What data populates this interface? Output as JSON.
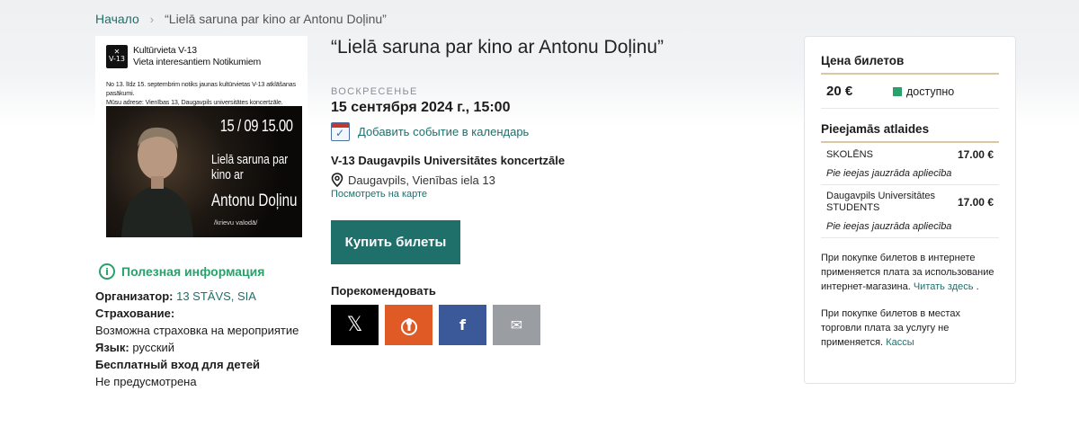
{
  "breadcrumb": {
    "home": "Начало",
    "separator": "›",
    "current": "“Lielā saruna par kino ar Antonu Doļinu”"
  },
  "poster": {
    "org_line1": "Kultūrvieta V-13",
    "org_line2": "Vieta interesantiem Notikumiem",
    "desc_line1": "No 13. līdz 15. septembrim notiks jaunas kultūrvietas V-13 atklāšanas pasākumi.",
    "desc_line2": "Mūsu adrese: Vienības 13, Daugavpils universitātes koncertzāle.",
    "date": "15 / 09 15.00",
    "title": "Lielā saruna par kino ar",
    "name": "Antonu Doļinu",
    "language": "/krievu valodā/"
  },
  "info": {
    "title": "Полезная информация",
    "organizer_label": "Организатор:",
    "organizer_value": "13 STĀVS, SIA",
    "insurance_label": "Страхование:",
    "insurance_value": "Возможна страховка на мероприятие",
    "language_label": "Язык:",
    "language_value": "русский",
    "kids_label": "Бесплатный вход для детей",
    "kids_value": "Не предусмотрена"
  },
  "event": {
    "title": "“Lielā saruna par kino ar Antonu Doļinu”",
    "weekday": "ВОСКРЕСЕНЬЕ",
    "datetime": "15 сентября 2024 г., 15:00",
    "calendar_link": "Добавить событие в календарь",
    "venue": "V-13 Daugavpils Universitātes koncertzāle",
    "address": "Daugavpils, Vienības iela 13",
    "map_link": "Посмотреть на карте",
    "buy_button": "Купить билеты",
    "recommend_label": "Порекомендовать",
    "share": {
      "x": "𝕏",
      "draugiem": "",
      "facebook": "f",
      "email": "✉"
    }
  },
  "prices": {
    "title": "Цена билетов",
    "items": [
      {
        "price": "20 €",
        "status": "доступно",
        "status_color": "#2aa06b"
      }
    ]
  },
  "discounts": {
    "title": "Pieejamās atlaides",
    "items": [
      {
        "name": "SKOLĒNS",
        "price": "17.00 €",
        "note": "Pie ieejas jauzrāda apliecība"
      },
      {
        "name": "Daugavpils Universitātes STUDENTS",
        "price": "17.00 €",
        "note": "Pie ieejas jauzrāda apliecība"
      }
    ]
  },
  "notes": {
    "online_fee": "При покупке билетов в интернете применяется плата за использование интернет-магазина.",
    "online_fee_link": "Читать здесь",
    "online_fee_end": ".",
    "offline_fee": "При покупке билетов в местах торговли плата за услугу не применяется.",
    "offline_fee_link": "Кассы"
  },
  "colors": {
    "accent": "#1f6f6b",
    "info_green": "#2aa06b",
    "divider_gold": "#d9c8a3"
  }
}
